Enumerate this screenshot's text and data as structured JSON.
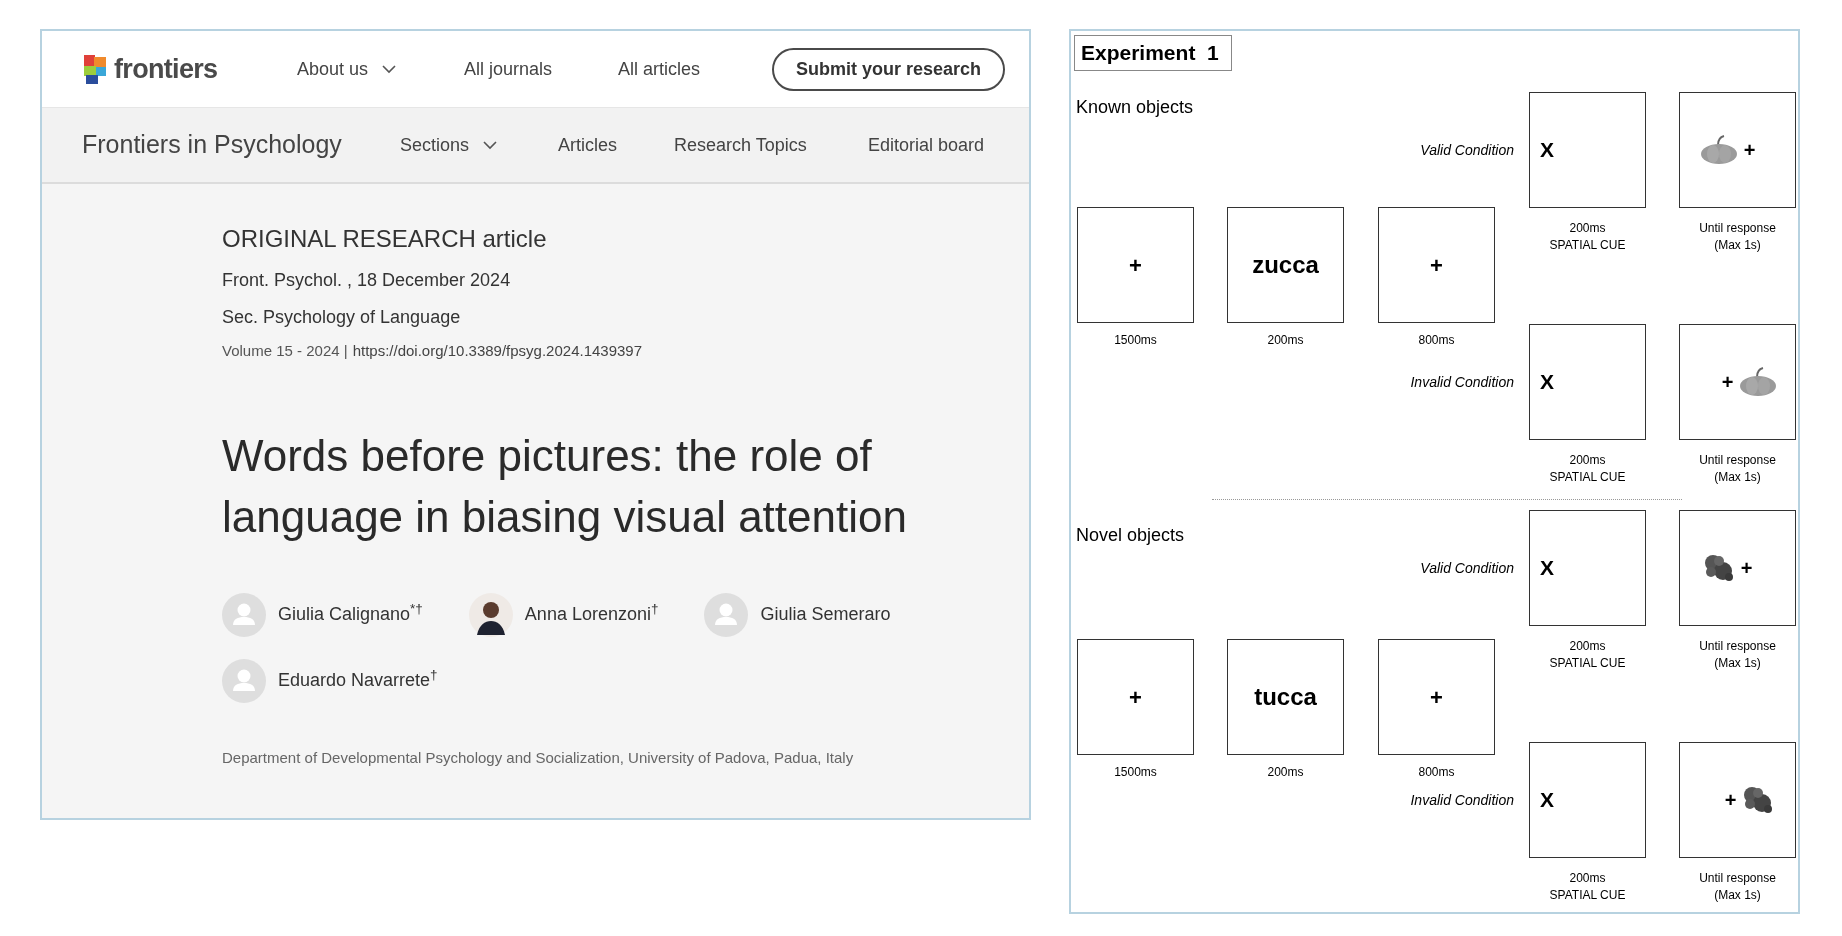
{
  "site_header": {
    "brand": "frontiers",
    "nav": [
      {
        "label": "About us",
        "dropdown": true
      },
      {
        "label": "All journals",
        "dropdown": false
      },
      {
        "label": "All articles",
        "dropdown": false
      }
    ],
    "cta": "Submit your research"
  },
  "journal_nav": {
    "journal": "Frontiers in Psychology",
    "items": [
      {
        "label": "Sections",
        "dropdown": true
      },
      {
        "label": "Articles",
        "dropdown": false
      },
      {
        "label": "Research Topics",
        "dropdown": false
      },
      {
        "label": "Editorial board",
        "dropdown": false
      }
    ]
  },
  "article": {
    "type": "ORIGINAL RESEARCH article",
    "citation": "Front. Psychol. , 18 December 2024",
    "section": "Sec. Psychology of Language",
    "volume": "Volume 15 - 2024 |",
    "doi": "https://doi.org/10.3389/fpsyg.2024.1439397",
    "title": "Words before pictures: the role of language in biasing visual attention",
    "authors": [
      {
        "name": "Giulia Calignano$^{*†}$",
        "kind": "placeholder"
      },
      {
        "name": "Anna Lorenzoni$^{†}$",
        "kind": "photo"
      },
      {
        "name": "Giulia Semeraro",
        "kind": "placeholder"
      },
      {
        "name": "Eduardo Navarrete$^{†}$",
        "kind": "placeholder"
      }
    ],
    "affiliation": "Department of Developmental Psychology and Socialization, University of Padova, Padua, Italy"
  },
  "figure": {
    "title": "Experiment  1",
    "sections": [
      {
        "heading": "Known objects",
        "kind": "pumpkin",
        "sequence": [
          {
            "kind": "fixation",
            "content": "+",
            "duration": "1500ms"
          },
          {
            "kind": "word",
            "content": "zucca",
            "duration": "200ms"
          },
          {
            "kind": "fixation",
            "content": "+",
            "duration": "800ms"
          }
        ],
        "conditions": [
          {
            "label": "Valid Condition",
            "cue": "X",
            "cue_duration": "200ms",
            "cue_label": "SPATIAL CUE",
            "fixation": "+",
            "kind": "left",
            "response": "Until response",
            "response_note": "(Max 1s)"
          },
          {
            "label": "Invalid Condition",
            "cue": "X",
            "cue_duration": "200ms",
            "cue_label": "SPATIAL CUE",
            "fixation": "+",
            "kind": "right",
            "response": "Until response",
            "response_note": "(Max 1s)"
          }
        ]
      },
      {
        "heading": "Novel objects",
        "kind": "novel",
        "sequence": [
          {
            "kind": "fixation",
            "content": "+",
            "duration": "1500ms"
          },
          {
            "kind": "word",
            "content": "tucca",
            "duration": "200ms"
          },
          {
            "kind": "fixation",
            "content": "+",
            "duration": "800ms"
          }
        ],
        "conditions": [
          {
            "label": "Valid Condition",
            "cue": "X",
            "cue_duration": "200ms",
            "cue_label": "SPATIAL CUE",
            "fixation": "+",
            "kind": "left",
            "response": "Until response",
            "response_note": "(Max 1s)"
          },
          {
            "label": "Invalid Condition",
            "cue": "X",
            "cue_duration": "200ms",
            "cue_label": "SPATIAL CUE",
            "fixation": "+",
            "kind": "right",
            "response": "Until response",
            "response_note": "(Max 1s)"
          }
        ]
      }
    ]
  }
}
